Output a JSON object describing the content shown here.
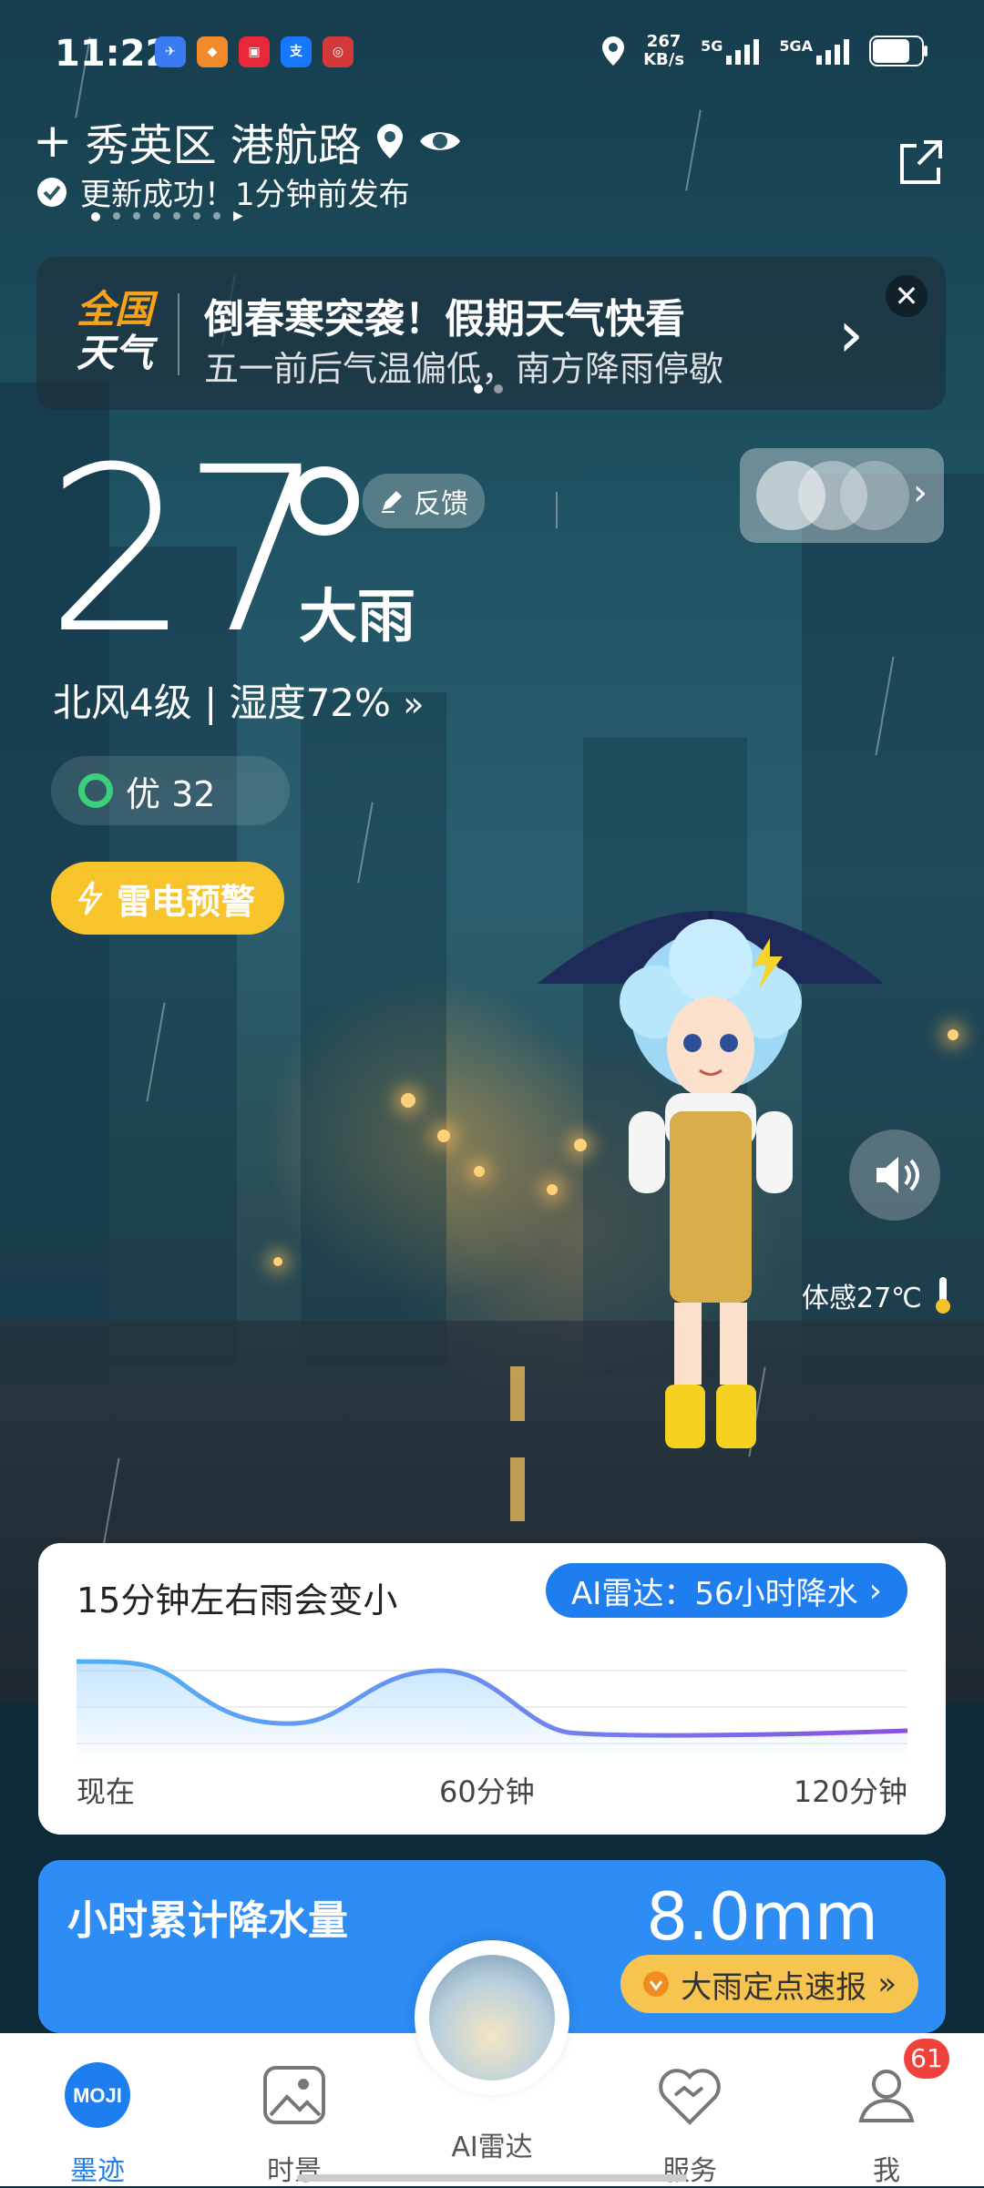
{
  "status_bar": {
    "time": "11:22",
    "net_speed": "267",
    "net_unit": "KB/s",
    "sig1": "5G",
    "sig2": "5GA"
  },
  "location": {
    "add_symbol": "+",
    "name": "秀英区 港航路",
    "update_text": "更新成功！1分钟前发布"
  },
  "banner": {
    "logo_line1": "全国",
    "logo_line2": "天气",
    "title": "倒春寒突袭！假期天气快看",
    "subtitle": "五一前后气温偏低，南方降雨停歇"
  },
  "current": {
    "temperature": "27",
    "condition": "大雨",
    "feedback_label": "反馈",
    "wind_humidity": "北风4级 | 湿度72%",
    "aqi_label": "优 32",
    "alert_label": "雷电预警",
    "feels_like": "体感27℃"
  },
  "rain_forecast": {
    "summary": "15分钟左右雨会变小",
    "radar_label": "AI雷达：56小时降水",
    "axis_labels": [
      "现在",
      "60分钟",
      "120分钟"
    ]
  },
  "precipitation": {
    "title": "小时累计降水量",
    "value": "8.0mm",
    "button_label": "大雨定点速报"
  },
  "bottom_nav": {
    "items": [
      {
        "label": "墨迹",
        "icon": "moji-logo-icon"
      },
      {
        "label": "时景",
        "icon": "photo-icon"
      },
      {
        "label": "AI雷达",
        "icon": "radar-globe-icon"
      },
      {
        "label": "服务",
        "icon": "heart-handshake-icon"
      },
      {
        "label": "我",
        "icon": "user-icon"
      }
    ],
    "badge_count": "61",
    "logo_text": "MOJI"
  },
  "colors": {
    "accent_blue": "#1e7ef0",
    "alert_yellow": "#f7c52b",
    "aqi_green": "#3ad17a",
    "badge_red": "#f0413c"
  }
}
